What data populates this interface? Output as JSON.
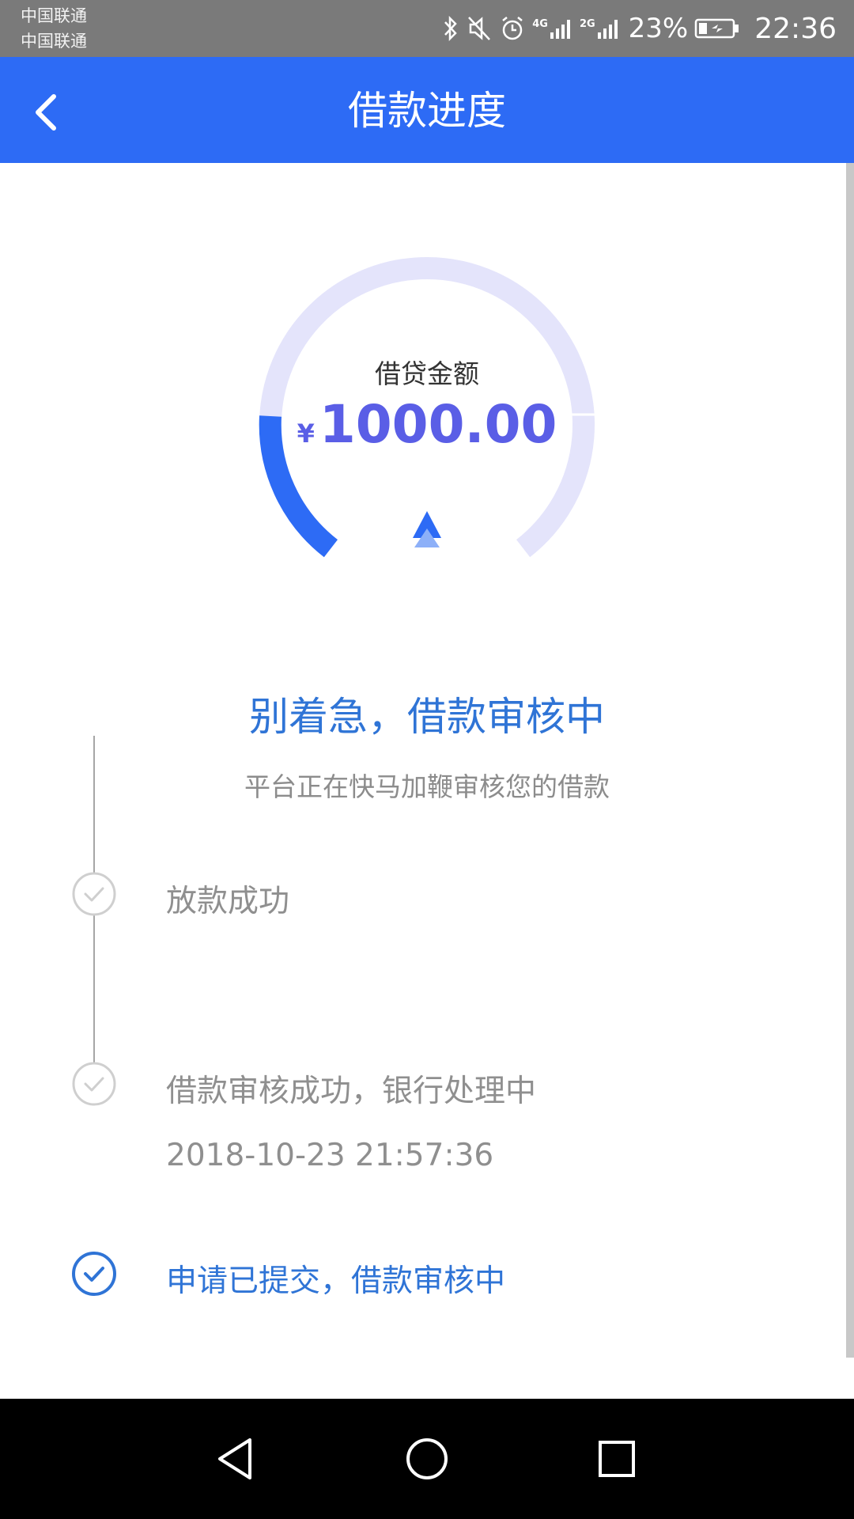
{
  "status_bar": {
    "carrier_1": "中国联通",
    "carrier_2": "中国联通",
    "network_1": "4G",
    "network_2": "2G",
    "battery": "23%",
    "time": "22:36",
    "icons": [
      "bluetooth-icon",
      "mute-icon",
      "alarm-icon",
      "signal-icon",
      "battery-icon"
    ]
  },
  "header": {
    "title": "借款进度",
    "back_icon": "chevron-left-icon"
  },
  "gauge": {
    "label": "借贷金额",
    "currency": "¥",
    "amount": "1000.00",
    "progress_fraction": 0.17,
    "track_color": "#e4e4fb",
    "progress_color": "#2d6bf5"
  },
  "status": {
    "headline": "别着急，借款审核中",
    "subline": "平台正在快马加鞭审核您的借款"
  },
  "steps": [
    {
      "label": "放款成功",
      "state": "pending"
    },
    {
      "label": "借款审核成功，银行处理中",
      "state": "pending"
    },
    {
      "label": "申请已提交，借款审核中",
      "state": "current",
      "time": "2018-10-23 21:57:36"
    }
  ],
  "colors": {
    "brand": "#2d6bf5",
    "accent_text": "#2f74d6",
    "amount": "#5a5ee6",
    "muted": "#8f8f8f"
  },
  "nav_bar": {
    "icons": [
      "back-triangle-icon",
      "home-circle-icon",
      "recents-square-icon"
    ]
  }
}
